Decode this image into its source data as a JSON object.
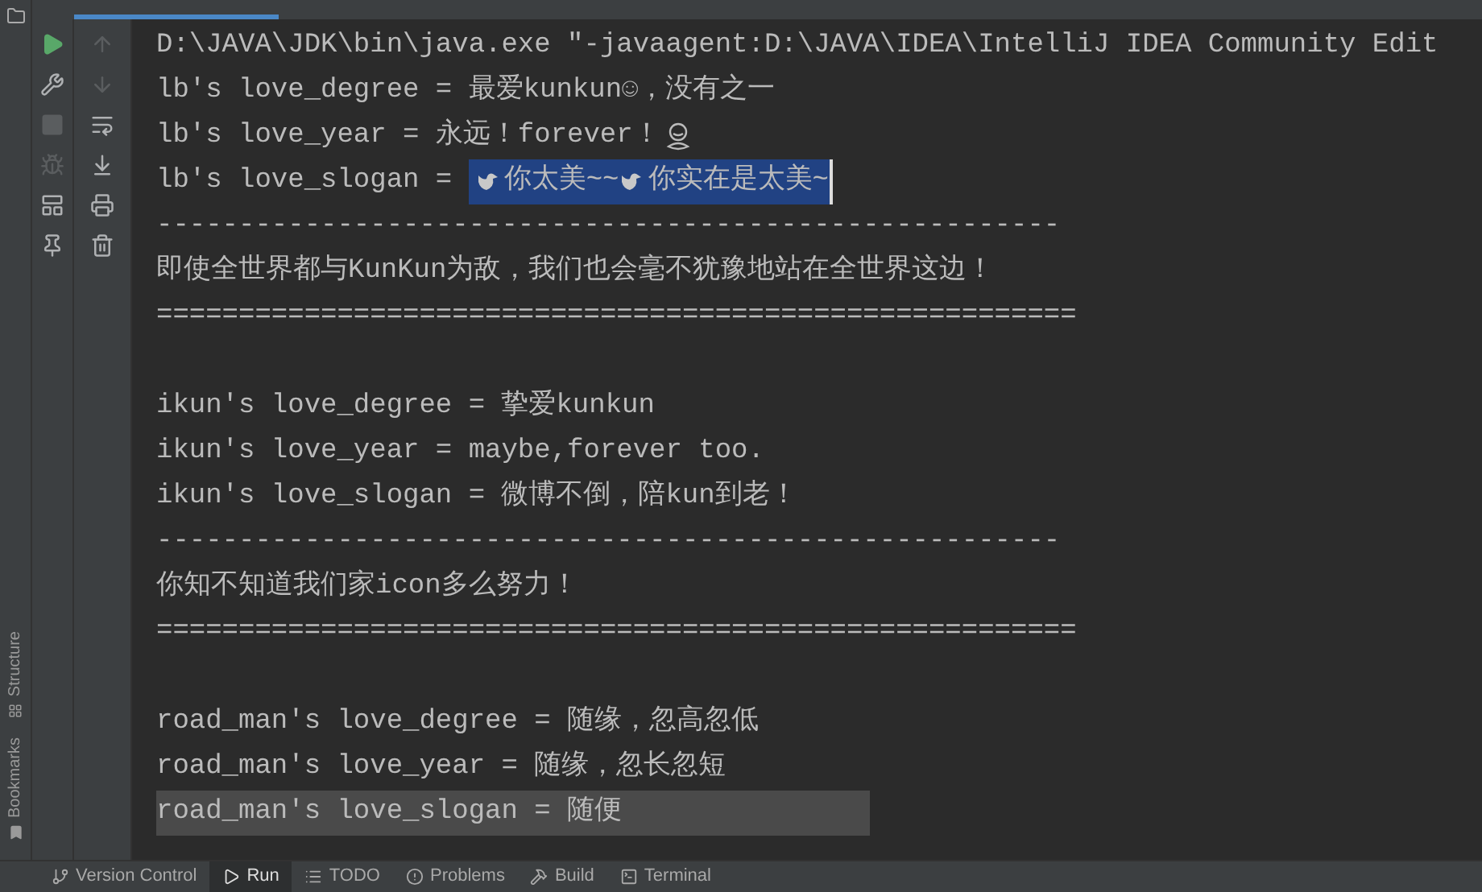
{
  "side_labels": [
    "Structure",
    "Bookmarks"
  ],
  "console": {
    "lines": [
      {
        "kind": "text",
        "text": "D:\\JAVA\\JDK\\bin\\java.exe \"-javaagent:D:\\JAVA\\IDEA\\IntelliJ IDEA Community Edit"
      },
      {
        "kind": "text",
        "text": "lb's love_degree = 最爱kunkun☺，没有之一"
      },
      {
        "kind": "text",
        "text": "lb's love_year = 永远！forever！",
        "figure_icon": true
      },
      {
        "kind": "selected",
        "text": "lb's love_slogan = ",
        "selection": [
          "你太美~~",
          "你实在是太美~"
        ]
      },
      {
        "kind": "text",
        "text": "-------------------------------------------------------"
      },
      {
        "kind": "text",
        "text": "即使全世界都与KunKun为敌，我们也会毫不犹豫地站在全世界这边！"
      },
      {
        "kind": "text",
        "text": "========================================================"
      },
      {
        "kind": "blank"
      },
      {
        "kind": "text",
        "text": "ikun's love_degree = 挚爱kunkun"
      },
      {
        "kind": "text",
        "text": "ikun's love_year = maybe,forever too."
      },
      {
        "kind": "text",
        "text": "ikun's love_slogan = 微博不倒，陪kun到老！"
      },
      {
        "kind": "text",
        "text": "-------------------------------------------------------"
      },
      {
        "kind": "text",
        "text": "你知不知道我们家icon多么努力！"
      },
      {
        "kind": "text",
        "text": "========================================================"
      },
      {
        "kind": "blank"
      },
      {
        "kind": "text",
        "text": "road_man's love_degree = 随缘，忽高忽低"
      },
      {
        "kind": "text",
        "text": "road_man's love_year = 随缘，忽长忽短"
      },
      {
        "kind": "hover",
        "text": "road_man's love_slogan = 随便"
      }
    ]
  },
  "bottom_tabs": [
    {
      "label": "Version Control",
      "selected": false
    },
    {
      "label": "Run",
      "selected": true
    },
    {
      "label": "TODO",
      "selected": false
    },
    {
      "label": "Problems",
      "selected": false
    },
    {
      "label": "Build",
      "selected": false
    },
    {
      "label": "Terminal",
      "selected": false
    }
  ]
}
